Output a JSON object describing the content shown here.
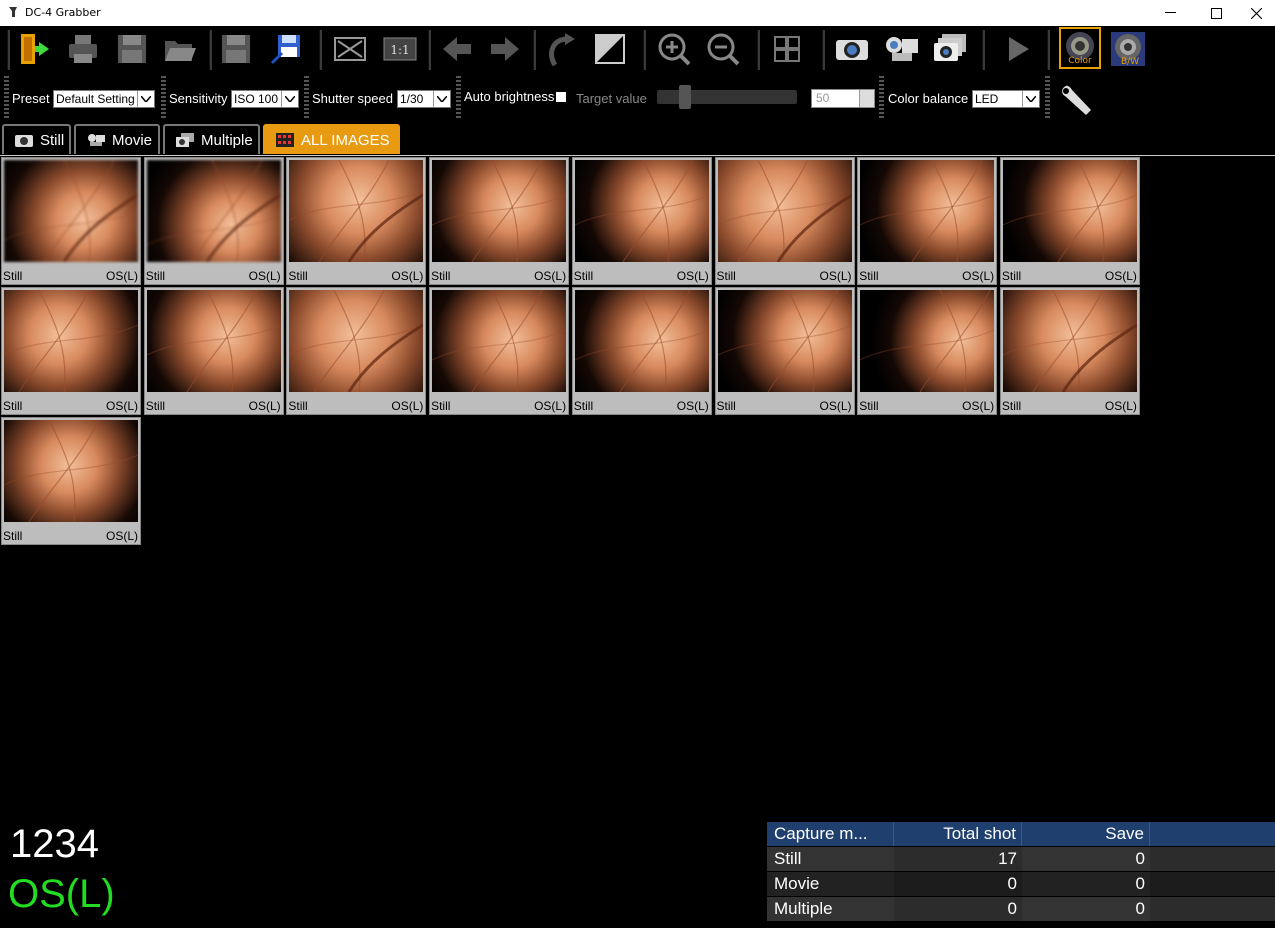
{
  "window": {
    "title": "DC-4 Grabber",
    "minimize": "—",
    "maximize": "☐",
    "close": "✕"
  },
  "toolbar": {
    "buttons": [
      "exit-icon",
      "print-icon",
      "save-all-icon",
      "open-folder-icon",
      "save-icon",
      "save-as-icon",
      "fit-window-icon",
      "actual-size-icon",
      "previous-icon",
      "next-icon",
      "undo-icon",
      "contrast-icon",
      "zoom-in-icon",
      "zoom-out-icon",
      "grid-view-icon",
      "still-camera-icon",
      "movie-camera-icon",
      "multiple-camera-icon",
      "play-icon",
      "color-mode-icon",
      "bw-mode-icon"
    ],
    "actual_size_label": "1:1",
    "color_label": "Color",
    "bw_label": "B/W"
  },
  "settings": {
    "preset_label": "Preset",
    "preset_value": "Default Setting",
    "sensitivity_label": "Sensitivity",
    "sensitivity_value": "ISO 100",
    "shutter_label": "Shutter speed",
    "shutter_value": "1/30",
    "auto_brightness_label": "Auto brightness",
    "auto_brightness_checked": false,
    "target_label": "Target value",
    "target_value": "50",
    "color_balance_label": "Color balance",
    "color_balance_value": "LED"
  },
  "tabs": [
    {
      "label": "Still",
      "active": false
    },
    {
      "label": "Movie",
      "active": false
    },
    {
      "label": "Multiple",
      "active": false
    },
    {
      "label": "ALL IMAGES",
      "active": true
    }
  ],
  "thumbnails": [
    {
      "type": "Still",
      "eye": "OS(L)"
    },
    {
      "type": "Still",
      "eye": "OS(L)"
    },
    {
      "type": "Still",
      "eye": "OS(L)"
    },
    {
      "type": "Still",
      "eye": "OS(L)"
    },
    {
      "type": "Still",
      "eye": "OS(L)"
    },
    {
      "type": "Still",
      "eye": "OS(L)"
    },
    {
      "type": "Still",
      "eye": "OS(L)"
    },
    {
      "type": "Still",
      "eye": "OS(L)"
    },
    {
      "type": "Still",
      "eye": "OS(L)"
    },
    {
      "type": "Still",
      "eye": "OS(L)"
    },
    {
      "type": "Still",
      "eye": "OS(L)"
    },
    {
      "type": "Still",
      "eye": "OS(L)"
    },
    {
      "type": "Still",
      "eye": "OS(L)"
    },
    {
      "type": "Still",
      "eye": "OS(L)"
    },
    {
      "type": "Still",
      "eye": "OS(L)"
    },
    {
      "type": "Still",
      "eye": "OS(L)"
    },
    {
      "type": "Still",
      "eye": "OS(L)"
    }
  ],
  "patient": {
    "id": "1234",
    "eye": "OS(L)"
  },
  "stats": {
    "headers": [
      "Capture m...",
      "Total shot",
      "Save"
    ],
    "rows": [
      {
        "mode": "Still",
        "total": "17",
        "save": "0"
      },
      {
        "mode": "Movie",
        "total": "0",
        "save": "0"
      },
      {
        "mode": "Multiple",
        "total": "0",
        "save": "0"
      }
    ]
  },
  "colors": {
    "accent": "#e89a10",
    "eye_text": "#22dd22",
    "table_header": "#1f3f6e"
  }
}
